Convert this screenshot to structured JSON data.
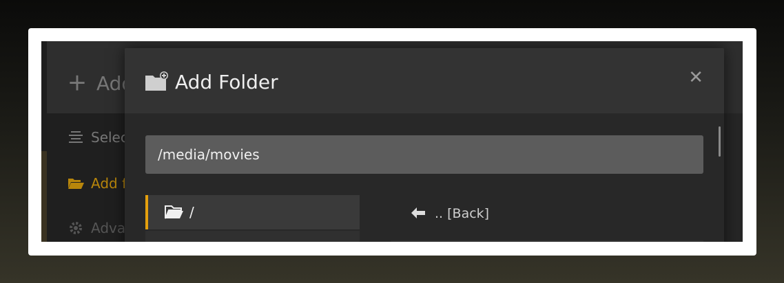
{
  "background_dialog": {
    "title": "Add",
    "sidebar": [
      {
        "label": "Selec",
        "icon": "align-center-icon"
      },
      {
        "label": "Add f",
        "icon": "folder-open-icon",
        "active": true
      },
      {
        "label": "Adva",
        "icon": "gear-icon"
      }
    ]
  },
  "modal": {
    "title": "Add Folder",
    "title_icon": "folder-plus-icon",
    "close_icon": "close-icon",
    "path_value": "/media/movies",
    "directories": [
      {
        "label": "/",
        "icon": "folder-open-icon",
        "selected": true
      }
    ],
    "subdirectories": [
      {
        "label": ".. [Back]",
        "icon": "arrow-left-icon"
      }
    ]
  },
  "colors": {
    "accent": "#e5a00d",
    "modal_bg": "#282828",
    "header_bg": "#333333",
    "input_bg": "#5c5c5c"
  }
}
